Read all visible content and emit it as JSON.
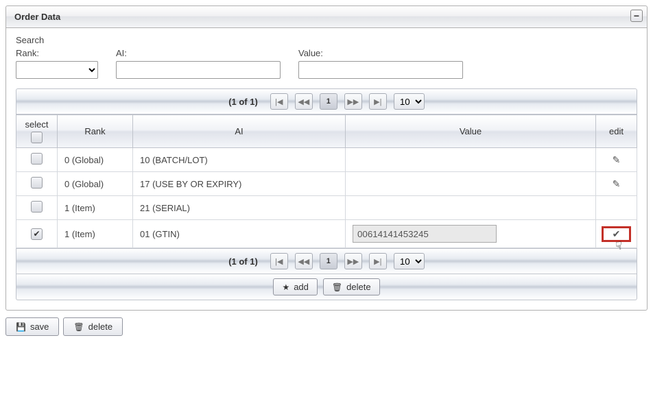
{
  "panel": {
    "title": "Order Data"
  },
  "search": {
    "title": "Search",
    "rank_label": "Rank:",
    "ai_label": "AI:",
    "value_label": "Value:",
    "rank_value": "",
    "ai_value": "",
    "value_value": ""
  },
  "paginator": {
    "page_info": "(1 of 1)",
    "current_page": "1",
    "rows_per_page": "10"
  },
  "table": {
    "headers": {
      "select": "select",
      "rank": "Rank",
      "ai": "AI",
      "value": "Value",
      "edit": "edit"
    },
    "rows": [
      {
        "checked": false,
        "rank": "0 (Global)",
        "ai": "10 (BATCH/LOT)",
        "value": "",
        "editing": false
      },
      {
        "checked": false,
        "rank": "0 (Global)",
        "ai": "17 (USE BY OR EXPIRY)",
        "value": "",
        "editing": false
      },
      {
        "checked": false,
        "rank": "1 (Item)",
        "ai": "21 (SERIAL)",
        "value": "",
        "editing": false,
        "no_edit_icon": true
      },
      {
        "checked": true,
        "rank": "1 (Item)",
        "ai": "01 (GTIN)",
        "value": "00614141453245",
        "editing": true
      }
    ]
  },
  "actions": {
    "add": "add",
    "delete": "delete"
  },
  "footer": {
    "save": "save",
    "delete": "delete"
  }
}
